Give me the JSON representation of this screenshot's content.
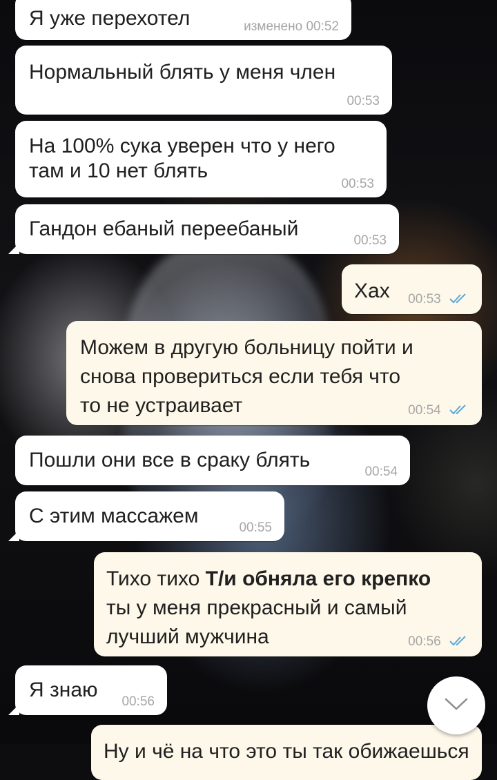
{
  "messages": [
    {
      "text": "Я уже перехотел",
      "edited_label": "изменено",
      "time": "00:52"
    },
    {
      "text": "Нормальный блять у меня член",
      "time": "00:53"
    },
    {
      "line1": "На 100% сука уверен что у него",
      "line2": "там и 10 нет блять",
      "time": "00:53"
    },
    {
      "text": "Гандон ебаный переебаный",
      "time": "00:53"
    },
    {
      "text": "Хах",
      "time": "00:53"
    },
    {
      "line1": "Можем в другую больницу пойти и",
      "line2": "снова провериться если тебя что",
      "line3": "то не устраивает",
      "time": "00:54"
    },
    {
      "text": "Пошли они все в сраку блять",
      "time": "00:54"
    },
    {
      "text": "С этим массажем",
      "time": "00:55"
    },
    {
      "prefix": "Тихо тихо ",
      "bold": "Т/и обняла его крепко",
      "line2": "ты у меня прекрасный и самый",
      "line3": "лучший мужчина",
      "time": "00:56"
    },
    {
      "text": "Я знаю",
      "time": "00:56"
    },
    {
      "text": "Ну и чё на что это ты так обижаешься"
    }
  ],
  "colors": {
    "incoming": "#ffffff",
    "outgoing": "#fdf8e9",
    "ticks": "#5ba8d8"
  },
  "icons": {
    "read_receipt": "double-check-icon",
    "scroll_down": "chevron-down-icon"
  }
}
